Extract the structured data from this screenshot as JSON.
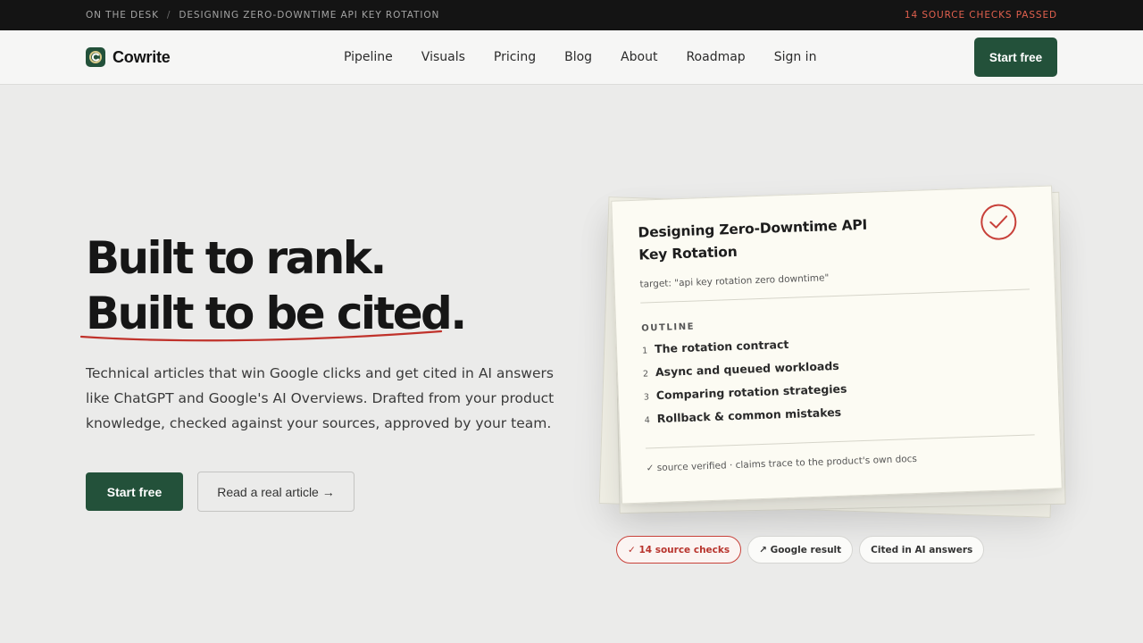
{
  "topbar": {
    "crumb_1": "ON THE DESK",
    "separator": "/",
    "crumb_2": "DESIGNING ZERO-DOWNTIME API KEY ROTATION",
    "status": "14 SOURCE CHECKS PASSED",
    "status_color": "#e0604e"
  },
  "nav": {
    "brand": "Cowrite",
    "logo_icon": "cowrite-logo-icon",
    "links": [
      "Pipeline",
      "Visuals",
      "Pricing",
      "Blog",
      "About",
      "Roadmap",
      "Sign in"
    ],
    "cta": "Start free"
  },
  "hero": {
    "title_line_1": "Built to rank.",
    "title_line_2": "Built to be cited.",
    "subtitle": "Technical articles that win Google clicks and get cited in AI answers like ChatGPT and Google's AI Overviews. Drafted from your product knowledge, checked against your sources, approved by your team.",
    "primary_cta": "Start free",
    "secondary_cta": "Read a real article →",
    "underline_color": "#c0322b"
  },
  "doc_card": {
    "title": "Designing Zero-Downtime API Key Rotation",
    "target": "target: \"api key rotation zero downtime\"",
    "outline_label": "OUTLINE",
    "outline": [
      {
        "num": "1",
        "text": "The rotation contract"
      },
      {
        "num": "2",
        "text": "Async and queued workloads"
      },
      {
        "num": "3",
        "text": "Comparing rotation strategies"
      },
      {
        "num": "4",
        "text": "Rollback & common mistakes"
      }
    ],
    "footer": "✓ source verified · claims trace to the product's own docs",
    "check_icon": "check-circle-icon"
  },
  "chips": {
    "source_checks": "✓ 14 source checks",
    "google": "↗ Google result",
    "cited": "Cited in AI answers"
  },
  "colors": {
    "brand_green": "#23513a",
    "accent_red": "#c8413a",
    "background": "#ebebea"
  }
}
